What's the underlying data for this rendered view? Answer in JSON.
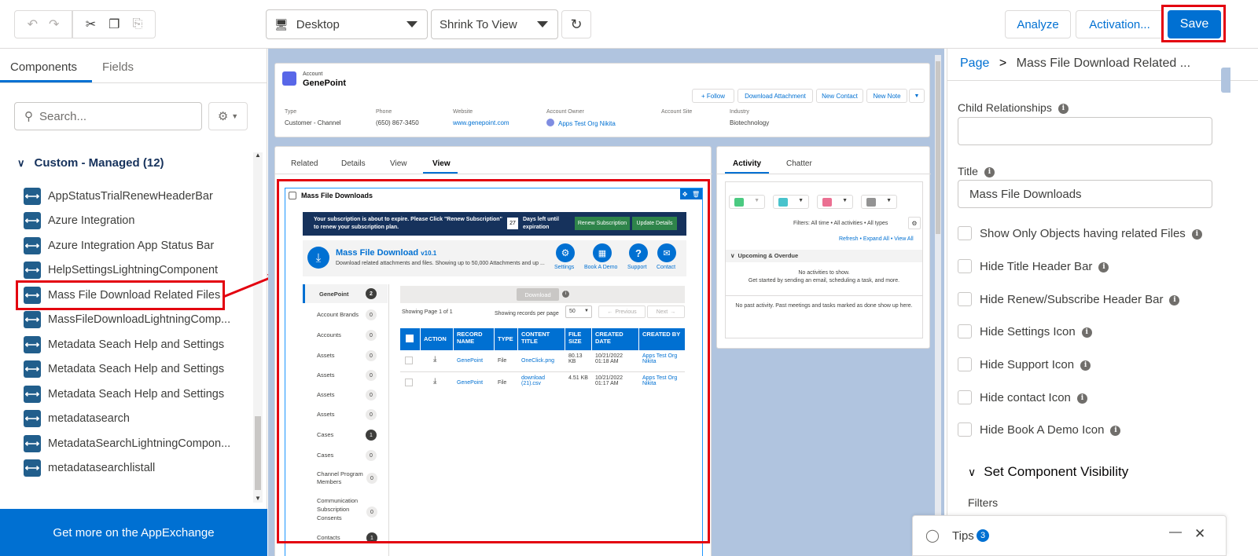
{
  "toolbar": {
    "device": "Desktop",
    "zoom": "Shrink To View",
    "analyze": "Analyze",
    "activation": "Activation...",
    "save": "Save"
  },
  "left": {
    "tabs": [
      "Components",
      "Fields"
    ],
    "search_placeholder": "Search...",
    "section": "Custom - Managed (12)",
    "items": [
      "AppStatusTrialRenewHeaderBar",
      "Azure Integration",
      "Azure Integration App Status Bar",
      "HelpSettingsLightningComponent",
      "Mass File Download Related Files",
      "MassFileDownloadLightningComp...",
      "Metadata Seach Help and Settings",
      "Metadata Seach Help and Settings",
      "Metadata Seach Help and Settings",
      "metadatasearch",
      "MetadataSearchLightningCompon...",
      "metadatasearchlistall"
    ],
    "appexchange": "Get more on the AppExchange"
  },
  "canvas": {
    "account": {
      "label": "Account",
      "name": "GenePoint",
      "buttons": [
        "+ Follow",
        "Download Attachment",
        "New Contact",
        "New Note"
      ],
      "fields": [
        {
          "label": "Type",
          "value": "Customer - Channel"
        },
        {
          "label": "Phone",
          "value": "(650) 867-3450"
        },
        {
          "label": "Website",
          "value": "www.genepoint.com"
        },
        {
          "label": "Account Owner",
          "value": "Apps Test Org Nikita"
        },
        {
          "label": "Account Site",
          "value": ""
        },
        {
          "label": "Industry",
          "value": "Biotechnology"
        }
      ]
    },
    "tabs": [
      "Related",
      "Details",
      "View",
      "View"
    ],
    "component_title": "Mass File Downloads",
    "banner": {
      "text": "Your subscription is about to expire. Please Click \"Renew Subscription\" to renew your subscription plan.",
      "days": "27",
      "days_text": "Days left until expiration",
      "renew": "Renew Subscription",
      "update": "Update Details"
    },
    "app": {
      "title": "Mass File Download",
      "version": "v10.1",
      "subtitle": "Download related attachments and files. Showing up to 50,000 Attachments and up ...",
      "actions": [
        "Settings",
        "Book A Demo",
        "Support",
        "Contact"
      ]
    },
    "nav": [
      {
        "label": "GenePoint",
        "count": "2"
      },
      {
        "label": "Account Brands",
        "count": "0"
      },
      {
        "label": "Accounts",
        "count": "0"
      },
      {
        "label": "Assets",
        "count": "0"
      },
      {
        "label": "Assets",
        "count": "0"
      },
      {
        "label": "Assets",
        "count": "0"
      },
      {
        "label": "Assets",
        "count": "0"
      },
      {
        "label": "Cases",
        "count": "1"
      },
      {
        "label": "Cases",
        "count": "0"
      },
      {
        "label": "Channel Program Members",
        "count": "0"
      },
      {
        "label": "Communication Subscription Consents",
        "count": "0"
      },
      {
        "label": "Contacts",
        "count": "1"
      }
    ],
    "download_btn": "Download",
    "paging": "Showing Page 1 of 1",
    "per_page_label": "Showing records per page",
    "per_page": "50",
    "prev": "Previous",
    "next": "Next",
    "columns": [
      "ACTION",
      "RECORD NAME",
      "TYPE",
      "CONTENT TITLE",
      "FILE SIZE",
      "CREATED DATE",
      "CREATED BY"
    ],
    "rows": [
      {
        "record": "GenePoint",
        "type": "File",
        "title": "OneClick.png",
        "size": "80.13 KB",
        "date": "10/21/2022 01:18 AM",
        "by": "Apps Test Org Nikita"
      },
      {
        "record": "GenePoint",
        "type": "File",
        "title": "download (21).csv",
        "size": "4.51 KB",
        "date": "10/21/2022 01:17 AM",
        "by": "Apps Test Org Nikita"
      }
    ],
    "activity": {
      "tabs": [
        "Activity",
        "Chatter"
      ],
      "filters": "Filters: All time • All activities • All types",
      "links": "Refresh • Expand All • View All",
      "upcoming": "Upcoming & Overdue",
      "none1": "No activities to show.",
      "none2": "Get started by sending an email, scheduling a task, and more.",
      "past": "No past activity. Past meetings and tasks marked as done show up here."
    }
  },
  "right": {
    "breadcrumb_page": "Page",
    "breadcrumb_sep": ">",
    "breadcrumb_current": "Mass File Download Related ...",
    "child_rel_label": "Child Relationships",
    "title_label": "Title",
    "title_value": "Mass File Downloads",
    "checkboxes": [
      "Show Only Objects having related Files",
      "Hide Title Header Bar",
      "Hide Renew/Subscribe Header Bar",
      "Hide Settings Icon",
      "Hide Support Icon",
      "Hide contact Icon",
      "Hide Book A Demo Icon"
    ],
    "visibility": "Set Component Visibility",
    "filters": "Filters",
    "tips": "Tips",
    "tips_count": "3"
  }
}
